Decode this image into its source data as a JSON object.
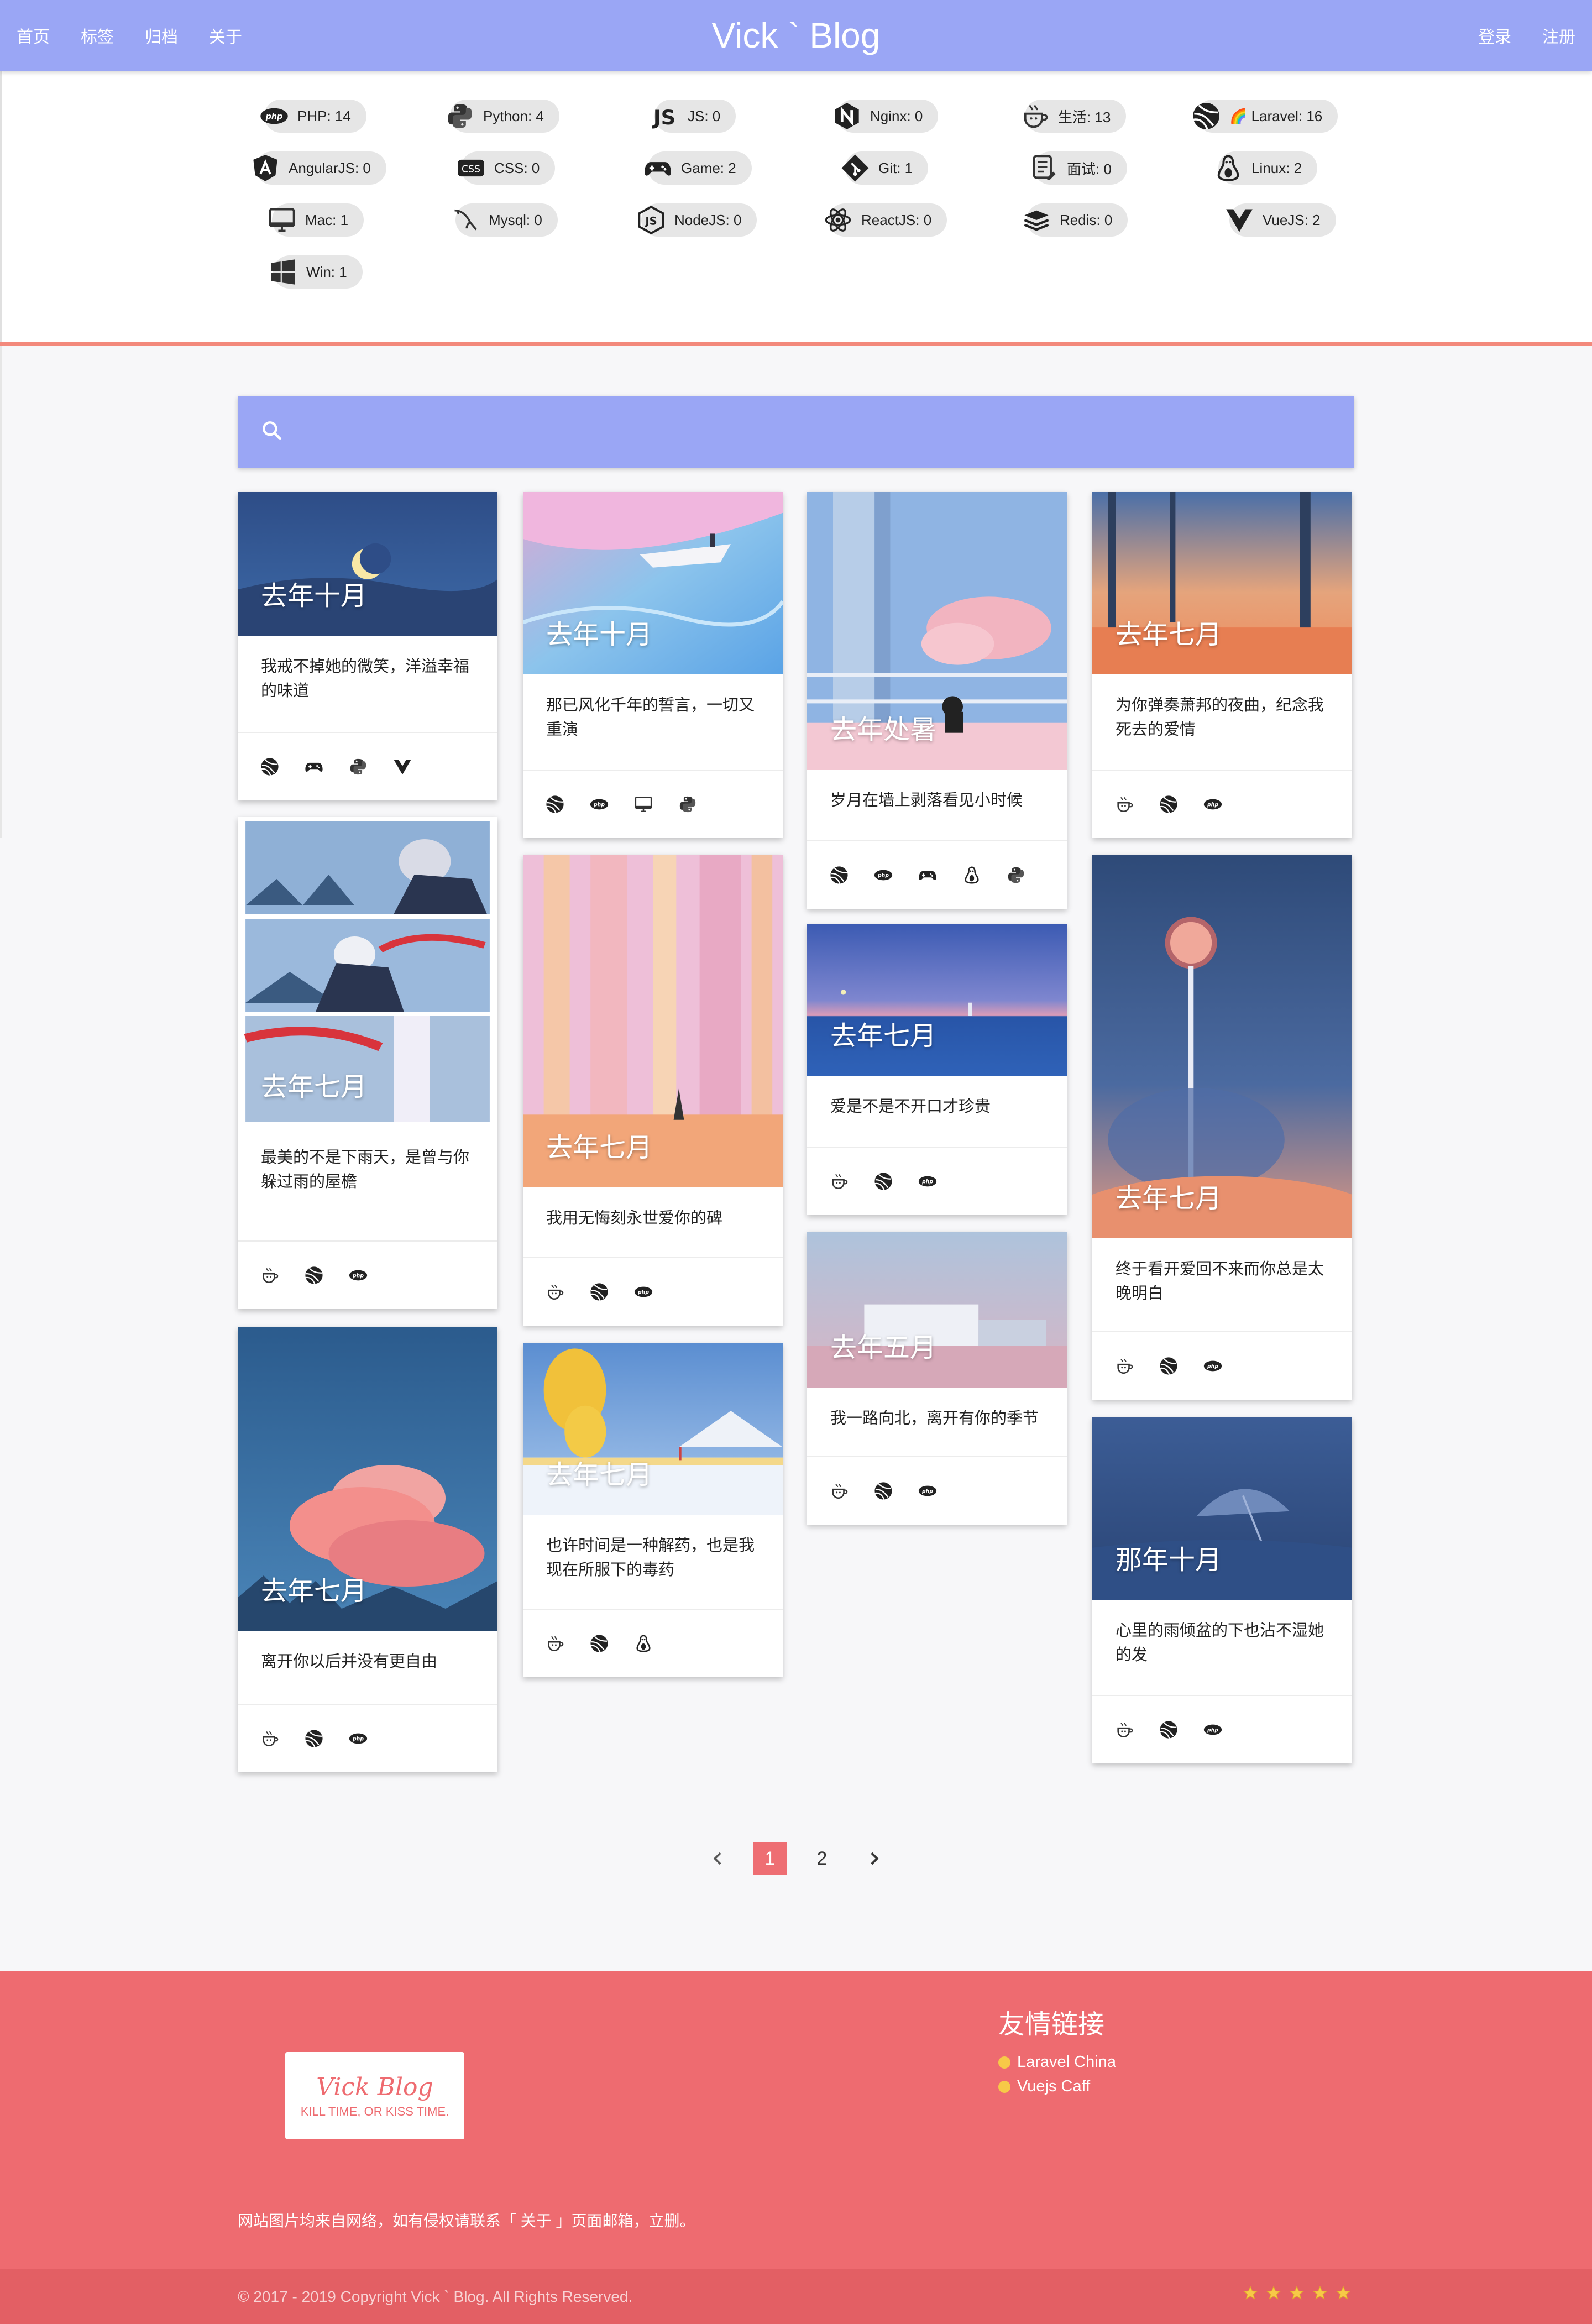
{
  "header": {
    "brand": "Vick ` Blog",
    "nav_left": [
      "首页",
      "标签",
      "归档",
      "关于"
    ],
    "nav_right": [
      "登录",
      "注册"
    ],
    "accent": "#9aa6f5"
  },
  "tags": [
    {
      "label": "PHP: 14",
      "icon": "php-icon"
    },
    {
      "label": "Python: 4",
      "icon": "python-icon"
    },
    {
      "label": "JS: 0",
      "icon": "js-icon"
    },
    {
      "label": "Nginx: 0",
      "icon": "nginx-icon"
    },
    {
      "label": "生活: 13",
      "icon": "coffee-cup-icon"
    },
    {
      "label": "🌈 Laravel: 16",
      "icon": "laravel-icon"
    },
    {
      "label": "AngularJS: 0",
      "icon": "angular-icon"
    },
    {
      "label": "CSS: 0",
      "icon": "css-icon"
    },
    {
      "label": "Game: 2",
      "icon": "gamepad-icon"
    },
    {
      "label": "Git: 1",
      "icon": "git-icon"
    },
    {
      "label": "面试: 0",
      "icon": "resume-icon"
    },
    {
      "label": "Linux: 2",
      "icon": "linux-icon"
    },
    {
      "label": "Mac: 1",
      "icon": "imac-icon"
    },
    {
      "label": "Mysql: 0",
      "icon": "mysql-icon"
    },
    {
      "label": "NodeJS: 0",
      "icon": "nodejs-icon"
    },
    {
      "label": "ReactJS: 0",
      "icon": "react-icon"
    },
    {
      "label": "Redis: 0",
      "icon": "redis-icon"
    },
    {
      "label": "VueJS: 2",
      "icon": "vue-icon"
    },
    {
      "label": "Win: 1",
      "icon": "windows-icon"
    }
  ],
  "search": {
    "placeholder": ""
  },
  "cards": [
    {
      "date": "去年十月",
      "title": "我戒不掉她的微笑，洋溢幸福的味道",
      "icons": [
        "laravel-icon",
        "gamepad-icon",
        "python-icon",
        "vue-icon"
      ]
    },
    {
      "date": "去年七月",
      "title": "最美的不是下雨天，是曾与你躲过雨的屋檐",
      "icons": [
        "coffee-cup-icon",
        "laravel-icon",
        "php-icon"
      ]
    },
    {
      "date": "去年七月",
      "title": "离开你以后并没有更自由",
      "icons": [
        "coffee-cup-icon",
        "laravel-icon",
        "php-icon"
      ]
    },
    {
      "date": "去年十月",
      "title": "那已风化千年的誓言，一切又重演",
      "icons": [
        "laravel-icon",
        "php-icon",
        "imac-icon",
        "python-icon"
      ]
    },
    {
      "date": "去年七月",
      "title": "我用无悔刻永世爱你的碑",
      "icons": [
        "coffee-cup-icon",
        "laravel-icon",
        "php-icon"
      ]
    },
    {
      "date": "去年七月",
      "title": "也许时间是一种解药，也是我现在所服下的毒药",
      "icons": [
        "coffee-cup-icon",
        "laravel-icon",
        "linux-icon"
      ]
    },
    {
      "date": "去年处暑",
      "title": "岁月在墙上剥落看见小时候",
      "icons": [
        "laravel-icon",
        "php-icon",
        "gamepad-icon",
        "linux-icon",
        "python-icon"
      ]
    },
    {
      "date": "去年七月",
      "title": "爱是不是不开口才珍贵",
      "icons": [
        "coffee-cup-icon",
        "laravel-icon",
        "php-icon"
      ]
    },
    {
      "date": "去年五月",
      "title": "我一路向北，离开有你的季节",
      "icons": [
        "coffee-cup-icon",
        "laravel-icon",
        "php-icon"
      ]
    },
    {
      "date": "去年七月",
      "title": "为你弹奏萧邦的夜曲，纪念我死去的爱情",
      "icons": [
        "coffee-cup-icon",
        "laravel-icon",
        "php-icon"
      ]
    },
    {
      "date": "去年七月",
      "title": "终于看开爱回不来而你总是太晚明白",
      "icons": [
        "coffee-cup-icon",
        "laravel-icon",
        "php-icon"
      ]
    },
    {
      "date": "那年十月",
      "title": "心里的雨倾盆的下也沾不湿她的发",
      "icons": [
        "coffee-cup-icon",
        "laravel-icon",
        "php-icon"
      ]
    }
  ],
  "pagination": {
    "prev": "‹",
    "pages": [
      "1",
      "2"
    ],
    "current": "1",
    "next": "›"
  },
  "footer": {
    "logo_script": "Vick Blog",
    "logo_tagline": "KILL TIME, OR KISS TIME.",
    "friends_title": "友情链接",
    "friends": [
      "Laravel China",
      "Vuejs Caff"
    ],
    "notice": "网站图片均来自网络，如有侵权请联系「 关于 」页面邮箱，立删。",
    "copyright": "© 2017 - 2019 Copyright Vick ` Blog. All Rights Reserved.",
    "stars": 5,
    "color": "#ee6b70"
  }
}
